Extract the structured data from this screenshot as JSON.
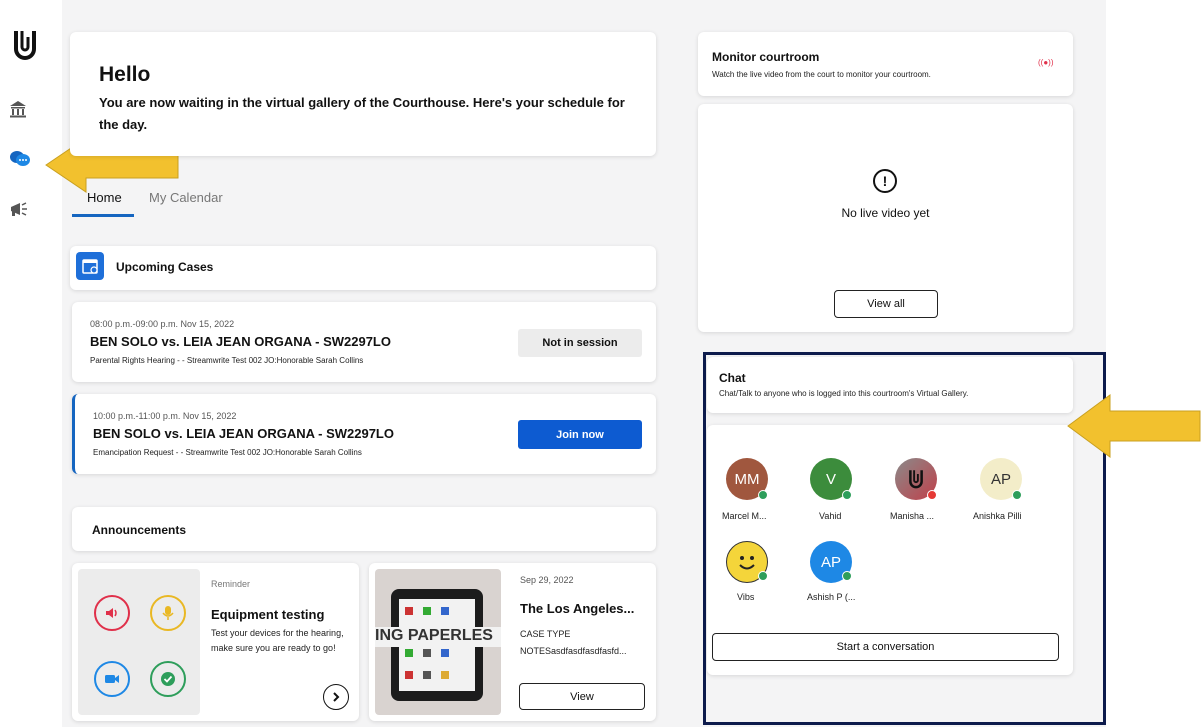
{
  "sidebar": {
    "icons": [
      "logo-icon",
      "courthouse-icon",
      "chat-icon",
      "megaphone-icon"
    ]
  },
  "hello": {
    "title": "Hello",
    "subtitle": "You are now waiting in the virtual gallery of the Courthouse. Here's your schedule for the day."
  },
  "tabs": [
    {
      "label": "Home"
    },
    {
      "label": "My Calendar"
    }
  ],
  "upcoming": {
    "title": "Upcoming Cases",
    "cases": [
      {
        "time": "08:00 p.m.-09:00 p.m. Nov 15, 2022",
        "title": "BEN SOLO vs. LEIA JEAN ORGANA - SW2297LO",
        "desc": "Parental Rights Hearing - - Streamwrite Test 002 JO:Honorable Sarah Collins",
        "action": "Not in session"
      },
      {
        "time": "10:00 p.m.-11:00 p.m. Nov 15, 2022",
        "title": "BEN SOLO vs. LEIA JEAN ORGANA - SW2297LO",
        "desc": "Emancipation Request - - Streamwrite Test 002 JO:Honorable Sarah Collins",
        "action": "Join now"
      }
    ]
  },
  "announcements": {
    "title": "Announcements",
    "card1": {
      "tag": "Reminder",
      "title": "Equipment testing",
      "body": "Test your devices for the hearing, make sure you are ready to go!"
    },
    "card2": {
      "date": "Sep 29, 2022",
      "title": "The Los Angeles...",
      "type_label": "CASE TYPE",
      "notes": "NOTESasdfasdfasdfasfd...",
      "button": "View",
      "image_text": "ING PAPERLES"
    }
  },
  "monitor": {
    "title": "Monitor courtroom",
    "subtitle": "Watch the live video from the court to monitor your courtroom.",
    "empty_text": "No live video yet",
    "button": "View all"
  },
  "chat": {
    "title": "Chat",
    "subtitle": "Chat/Talk to anyone who is logged into this courtroom's Virtual Gallery.",
    "button": "Start a conversation",
    "people": [
      {
        "initials": "MM",
        "name": "Marcel M...",
        "color": "#a0573e",
        "status": "#2e9e5b"
      },
      {
        "initials": "V",
        "name": "Vahid",
        "color": "#3c8c3c",
        "status": "#2e9e5b"
      },
      {
        "initials": "",
        "name": "Manisha ...",
        "color": "#c0404a",
        "status": "#e53935"
      },
      {
        "initials": "AP",
        "name": "Anishka Pilli",
        "color": "#f3edc9",
        "status": "#2e9e5b"
      },
      {
        "initials": "",
        "name": "Vibs",
        "color": "#f4d53a",
        "status": "#2e9e5b"
      },
      {
        "initials": "AP",
        "name": "Ashish P (...",
        "color": "#1e88e5",
        "status": "#2e9e5b"
      }
    ]
  },
  "colors": {
    "accent": "#0d5bd1",
    "highlight_border": "#0d1b4c",
    "arrow": "#f2c12e"
  }
}
